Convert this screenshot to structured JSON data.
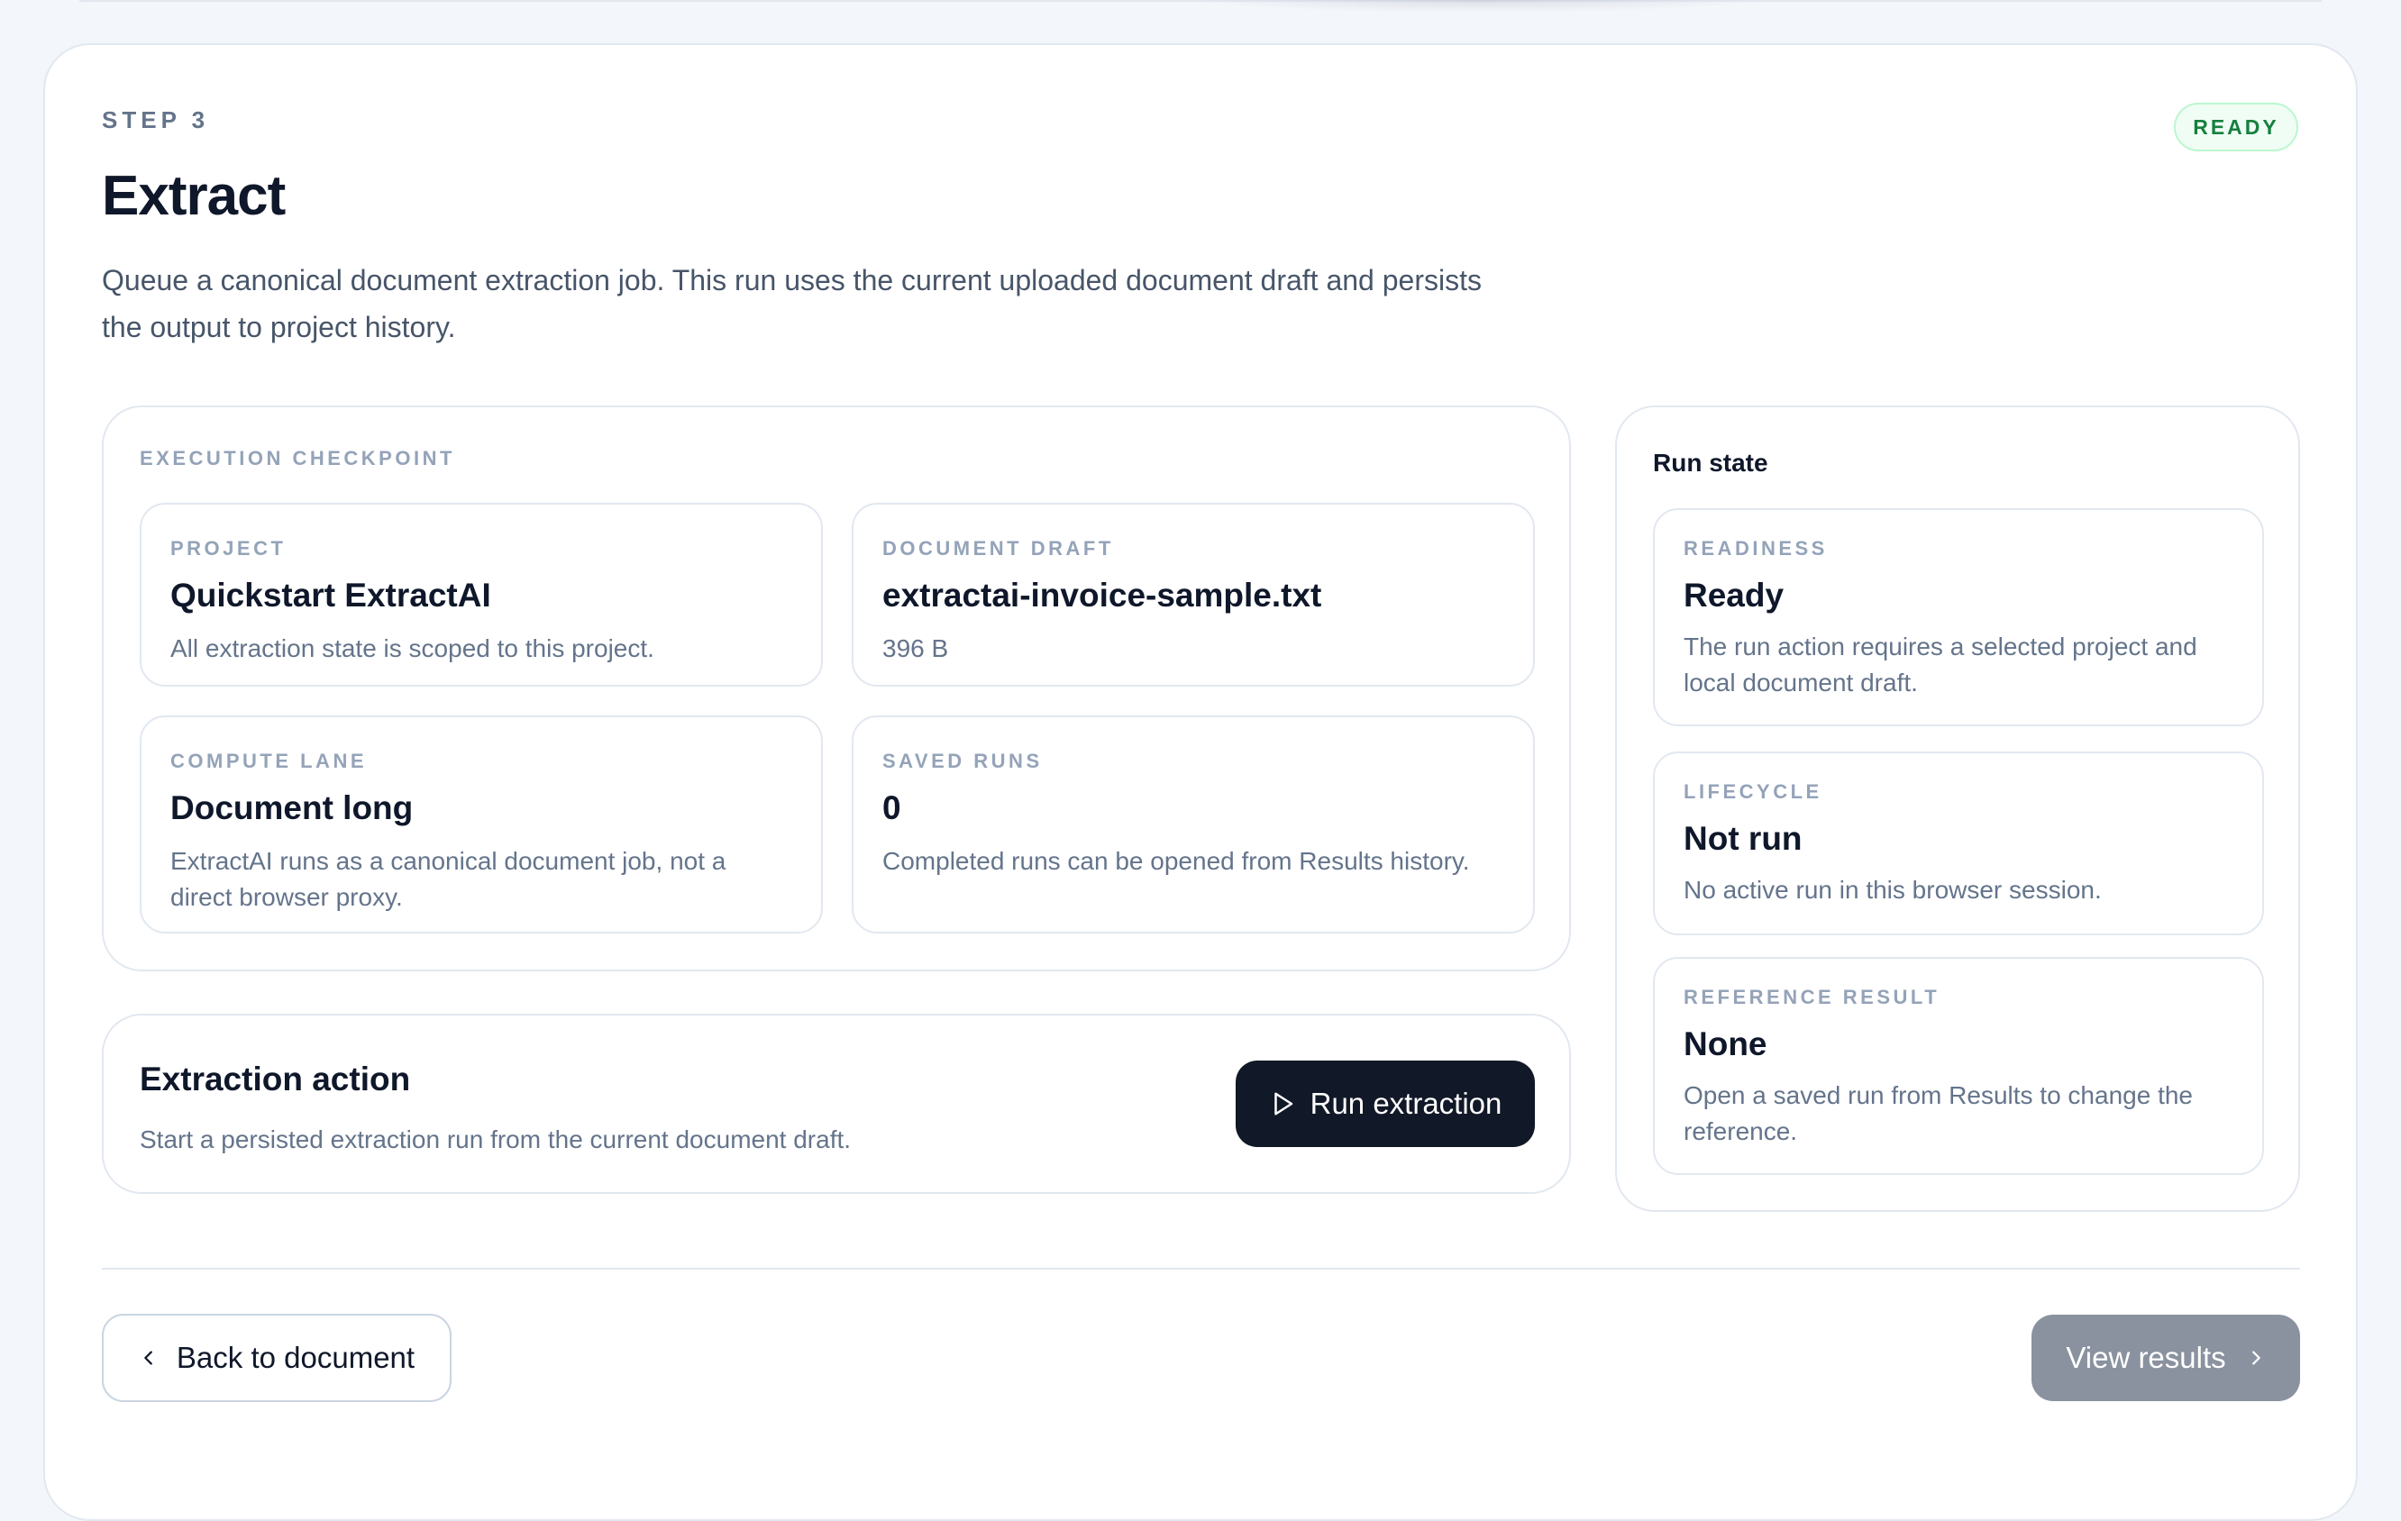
{
  "header": {
    "step_label": "STEP 3",
    "title": "Extract",
    "status_badge": "READY",
    "description": "Queue a canonical document extraction job. This run uses the current uploaded document draft and persists the output to project history."
  },
  "checkpoint": {
    "section_label": "EXECUTION CHECKPOINT",
    "tiles": [
      {
        "label": "PROJECT",
        "value": "Quickstart ExtractAI",
        "note": "All extraction state is scoped to this project."
      },
      {
        "label": "DOCUMENT DRAFT",
        "value": "extractai-invoice-sample.txt",
        "note": "396 B"
      },
      {
        "label": "COMPUTE LANE",
        "value": "Document long",
        "note": "ExtractAI runs as a canonical document job, not a direct browser proxy."
      },
      {
        "label": "SAVED RUNS",
        "value": "0",
        "note": "Completed runs can be opened from Results history."
      }
    ]
  },
  "action": {
    "title": "Extraction action",
    "description": "Start a persisted extraction run from the current document draft.",
    "run_button_label": "Run extraction",
    "run_button_icon": "play-icon"
  },
  "run_state": {
    "title": "Run state",
    "tiles": [
      {
        "label": "READINESS",
        "value": "Ready",
        "note": "The run action requires a selected project and local document draft."
      },
      {
        "label": "LIFECYCLE",
        "value": "Not run",
        "note": "No active run in this browser session."
      },
      {
        "label": "REFERENCE RESULT",
        "value": "None",
        "note": "Open a saved run from Results to change the reference."
      }
    ]
  },
  "footer": {
    "back_button_label": "Back to document",
    "back_button_icon": "chevron-left-icon",
    "view_button_label": "View results",
    "view_button_icon": "chevron-right-icon"
  },
  "colors": {
    "primary_button": "#111827",
    "disabled_button": "#8a929f",
    "ready_badge_text": "#15803d",
    "ready_badge_bg": "#f0fdf4"
  }
}
